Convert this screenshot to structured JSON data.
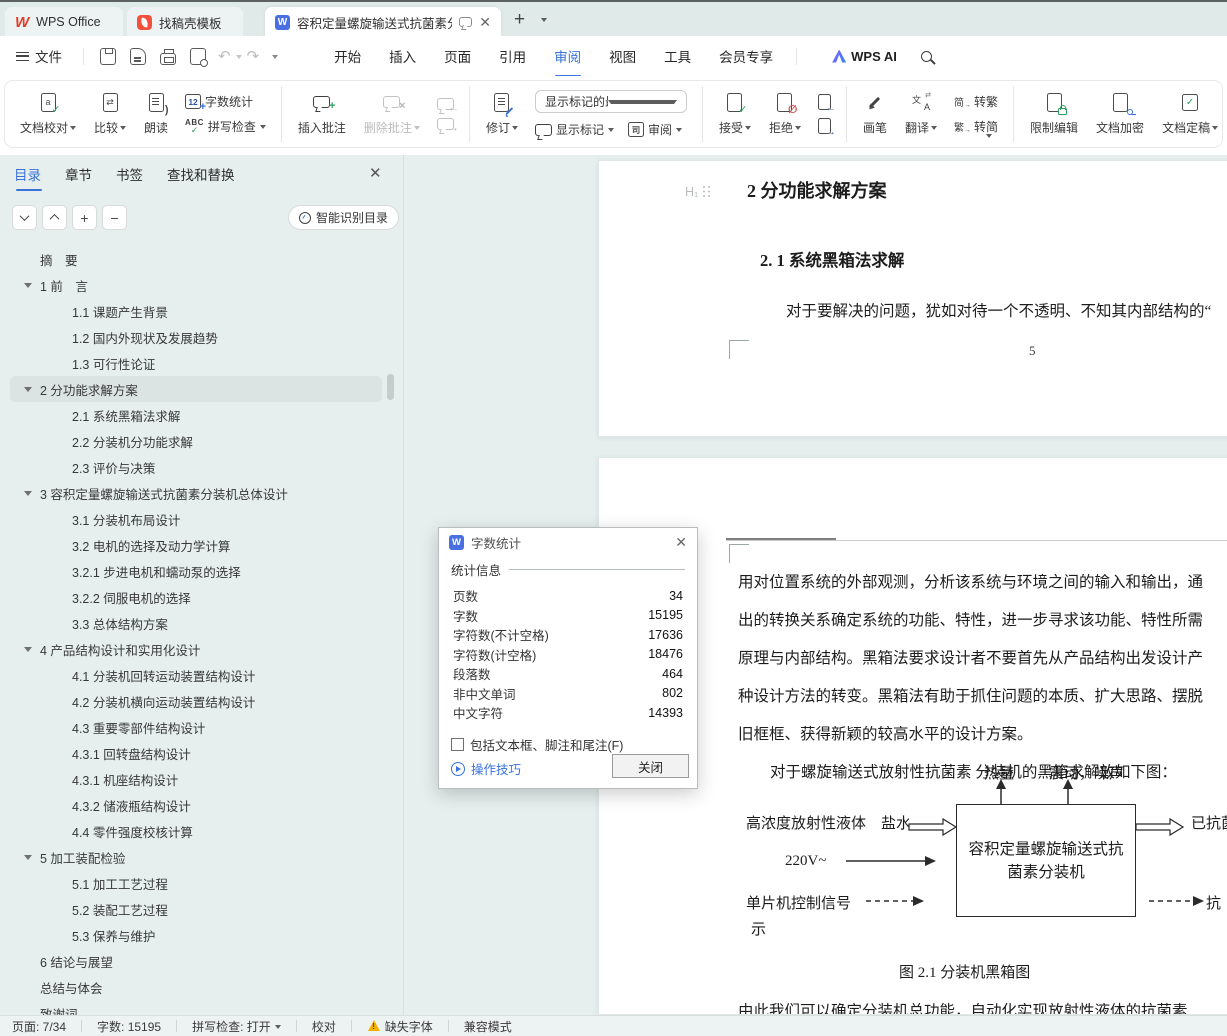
{
  "colors": {
    "accent": "#3873d9",
    "green": "#2f9e5e",
    "red": "#cf4b4b",
    "warning": "#f2b200"
  },
  "tabbar": {
    "tabs": [
      {
        "label": "WPS Office"
      },
      {
        "label": "找稿壳模板"
      },
      {
        "label": "容积定量螺旋输送式抗菌素分装",
        "active": true
      }
    ]
  },
  "menubar": {
    "file": "文件",
    "items": [
      {
        "label": "开始"
      },
      {
        "label": "插入"
      },
      {
        "label": "页面"
      },
      {
        "label": "引用"
      },
      {
        "label": "审阅",
        "active": true
      },
      {
        "label": "视图"
      },
      {
        "label": "工具"
      },
      {
        "label": "会员专享"
      }
    ],
    "wps_ai": "WPS AI"
  },
  "ribbon": {
    "proof": "文档校对",
    "compare": "比较",
    "read_aloud": "朗读",
    "word_count": "字数统计",
    "spell_check": "拼写检查",
    "insert_comment": "插入批注",
    "delete_comment": "删除批注",
    "track_changes": "修订",
    "markup_state": "显示标记的最终状态",
    "show_markup": "显示标记",
    "review": "审阅",
    "accept": "接受",
    "reject": "拒绝",
    "pen": "画笔",
    "translate": "翻译",
    "s2t_icon": "简",
    "s2t": "转繁",
    "t2s_icon": "繁",
    "t2s": "转简",
    "restrict": "限制编辑",
    "encrypt": "文档加密",
    "finalize": "文档定稿"
  },
  "sidebar": {
    "tabs": [
      {
        "label": "目录",
        "active": true
      },
      {
        "label": "章节"
      },
      {
        "label": "书签"
      },
      {
        "label": "查找和替换"
      }
    ],
    "smart_toc": "智能识别目录",
    "toc": [
      {
        "label": "摘　要",
        "level": 0
      },
      {
        "label": "1 前　言",
        "level": 0,
        "arrow": true
      },
      {
        "label": "1.1 课题产生背景",
        "level": 1
      },
      {
        "label": "1.2 国内外现状及发展趋势",
        "level": 1
      },
      {
        "label": "1.3 可行性论证",
        "level": 1
      },
      {
        "label": "2 分功能求解方案",
        "level": 0,
        "arrow": true,
        "selected": true
      },
      {
        "label": "2.1 系统黑箱法求解",
        "level": 1
      },
      {
        "label": "2.2 分装机分功能求解",
        "level": 1
      },
      {
        "label": "2.3 评价与决策",
        "level": 1
      },
      {
        "label": "3 容积定量螺旋输送式抗菌素分装机总体设计",
        "level": 0,
        "arrow": true
      },
      {
        "label": "3.1 分装机布局设计",
        "level": 1
      },
      {
        "label": "3.2 电机的选择及动力学计算",
        "level": 1
      },
      {
        "label": "3.2.1 步进电机和蠕动泵的选择",
        "level": 1
      },
      {
        "label": "3.2.2 伺服电机的选择",
        "level": 1
      },
      {
        "label": "3.3 总体结构方案",
        "level": 1
      },
      {
        "label": "4 产品结构设计和实用化设计",
        "level": 0,
        "arrow": true
      },
      {
        "label": "4.1  分装机回转运动装置结构设计",
        "level": 1
      },
      {
        "label": "4.2 分装机横向运动装置结构设计",
        "level": 1
      },
      {
        "label": "4.3  重要零部件结构设计",
        "level": 1
      },
      {
        "label": "4.3.1 回转盘结构设计",
        "level": 1
      },
      {
        "label": "4.3.1 机座结构设计",
        "level": 1
      },
      {
        "label": "4.3.2 储液瓶结构设计",
        "level": 1
      },
      {
        "label": "4.4 零件强度校核计算",
        "level": 1
      },
      {
        "label": "5 加工装配检验",
        "level": 0,
        "arrow": true
      },
      {
        "label": "5.1 加工工艺过程",
        "level": 1
      },
      {
        "label": "5.2 装配工艺过程",
        "level": 1
      },
      {
        "label": "5.3 保养与维护",
        "level": 1
      },
      {
        "label": "6 结论与展望",
        "level": 0
      },
      {
        "label": "总结与体会",
        "level": 0
      },
      {
        "label": "致谢词",
        "level": 0
      }
    ]
  },
  "document": {
    "page1": {
      "h_tag": "H₁",
      "heading": "2 分功能求解方案",
      "subheading": "2. 1 系统黑箱法求解",
      "para": "对于要解决的问题，犹如对待一个不透明、不知其内部结构的“",
      "page_number": "5"
    },
    "page2": {
      "lines": [
        {
          "text": "用对位置系统的外部观测，分析该系统与环境之间的输入和输出，通"
        },
        {
          "text": "出的转换关系确定系统的功能、特性，进一步寻求该功能、特性所需"
        },
        {
          "text": "原理与内部结构。黑箱法要求设计者不要首先从产品结构出发设计产"
        },
        {
          "text": "种设计方法的转变。黑箱法有助于抓住问题的本质、扩大思路、摆脱"
        },
        {
          "text": "旧框框、获得新颖的较高水平的设计方案。"
        }
      ],
      "lead": "对于螺旋输送式放射性抗菌素 分装机的黑箱求解放如下图：",
      "diagram": {
        "top_out1": "热量",
        "top_out2": "震动，噪声",
        "in1": "高浓度放射性液体　盐水",
        "in2": "220V~",
        "in3": "单片机控制信号",
        "box_line1": "容积定量螺旋输送式抗",
        "box_line2": "菌素分装机",
        "out1": "已抗菌",
        "out2": "抗",
        "stray": "示"
      },
      "caption": "图 2.1 分装机黑箱图",
      "partial_last": "由此我们可以确定分装机总功能，自动化实现放射性液体的抗菌素"
    }
  },
  "dialog": {
    "title": "字数统计",
    "section": "统计信息",
    "rows": [
      {
        "label": "页数",
        "value": "34"
      },
      {
        "label": "字数",
        "value": "15195"
      },
      {
        "label": "字符数(不计空格)",
        "value": "17636"
      },
      {
        "label": "字符数(计空格)",
        "value": "18476"
      },
      {
        "label": "段落数",
        "value": "464"
      },
      {
        "label": "非中文单词",
        "value": "802"
      },
      {
        "label": "中文字符",
        "value": "14393"
      }
    ],
    "checkbox": "包括文本框、脚注和尾注(F)",
    "tips": "操作技巧",
    "close": "关闭"
  },
  "statusbar": {
    "page": "页面: 7/34",
    "words": "字数: 15195",
    "spell": "拼写检查: 打开",
    "proof": "校对",
    "missing_font": "缺失字体",
    "compat": "兼容模式"
  }
}
